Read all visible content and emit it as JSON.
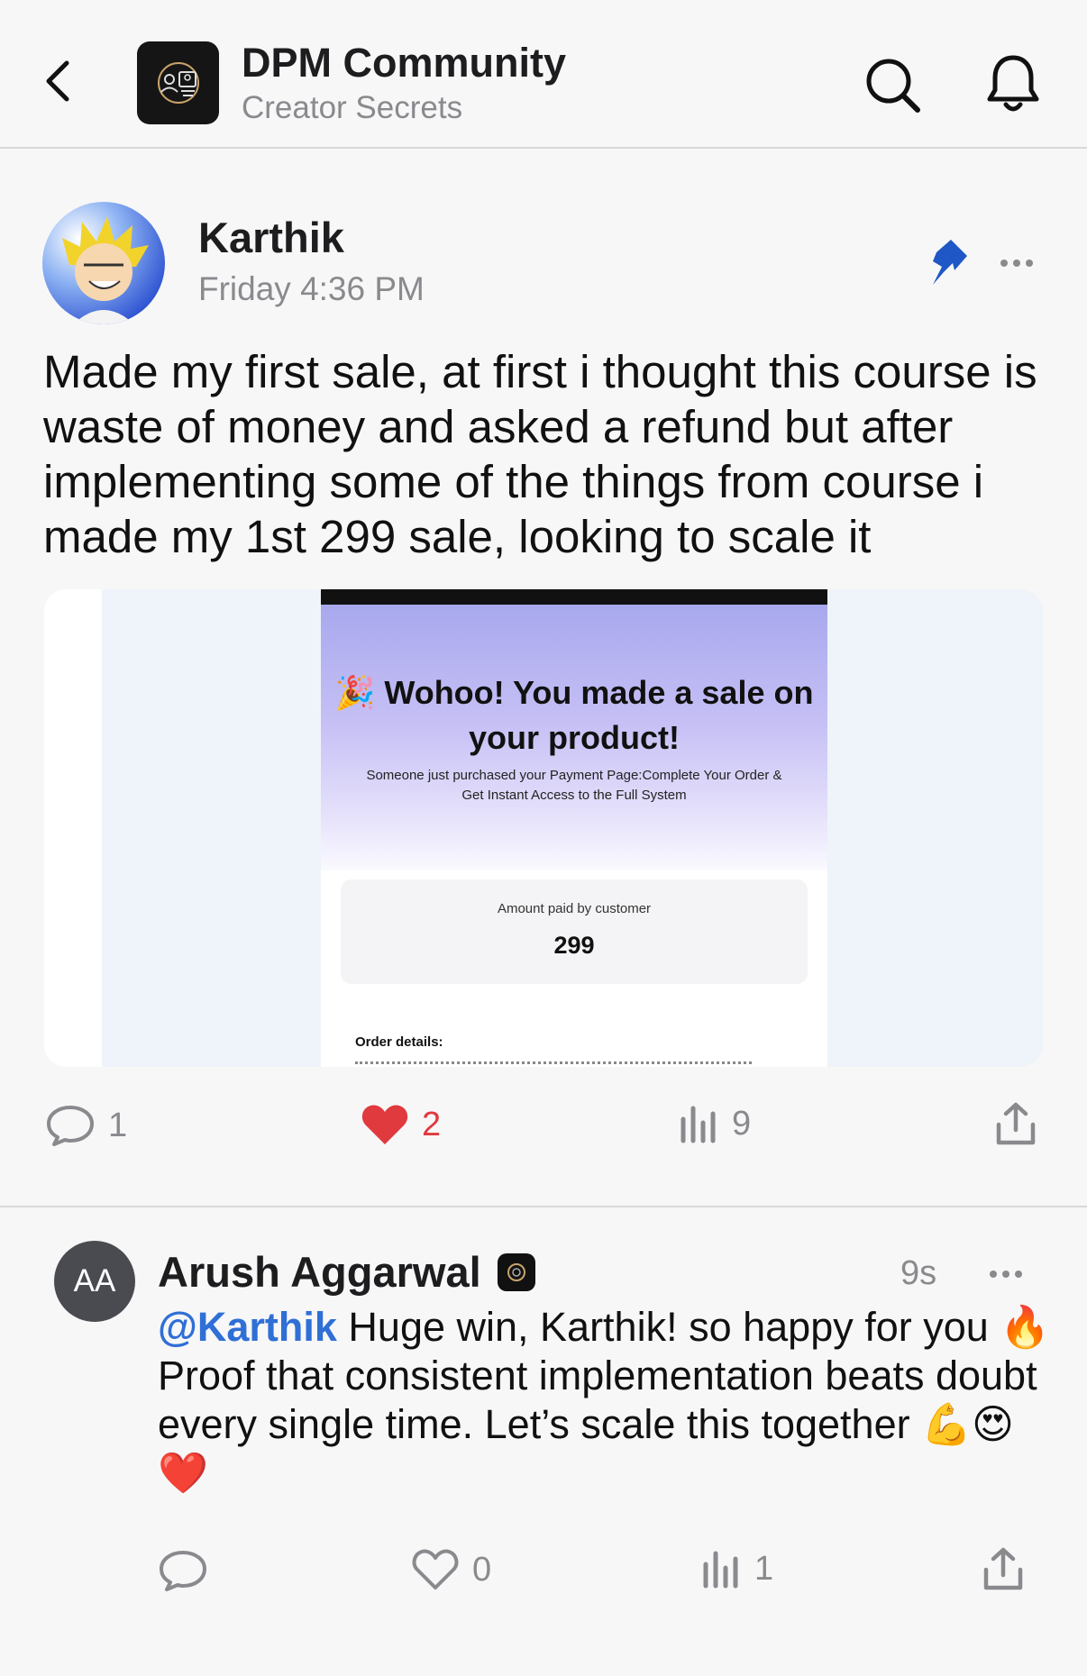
{
  "header": {
    "community_name": "DPM Community",
    "subtitle": "Creator Secrets",
    "icons": [
      "back-chevron-icon",
      "community-logo",
      "search-icon",
      "bell-icon"
    ]
  },
  "post": {
    "author": "Karthik",
    "timestamp": "Friday 4:36 PM",
    "pinned": true,
    "body": "Made my first sale, at first i thought this course is waste of money and asked a refund but after implementing some of the things from course i made my 1st 299 sale, looking to scale it",
    "attachment": {
      "title_emoji": "🎉",
      "title": "Wohoo! You made a sale on your product!",
      "description": "Someone just purchased your Payment Page:Complete Your Order & Get Instant Access to the Full System",
      "amount_label": "Amount paid by customer",
      "amount_value": "299",
      "order_label": "Order details:"
    },
    "stats": {
      "comments": "1",
      "likes": "2",
      "views": "9"
    },
    "like_color": "#e0393e"
  },
  "comment": {
    "avatar_initials": "AA",
    "author": "Arush Aggarwal",
    "time": "9s",
    "mention": "@Karthik",
    "body": " Huge win, Karthik! so happy for you 🔥 Proof that consistent implementation beats doubt every single time. Let’s scale this together 💪😍❤️",
    "stats": {
      "likes": "0",
      "views": "1"
    },
    "mention_color": "#2f6fd6"
  }
}
